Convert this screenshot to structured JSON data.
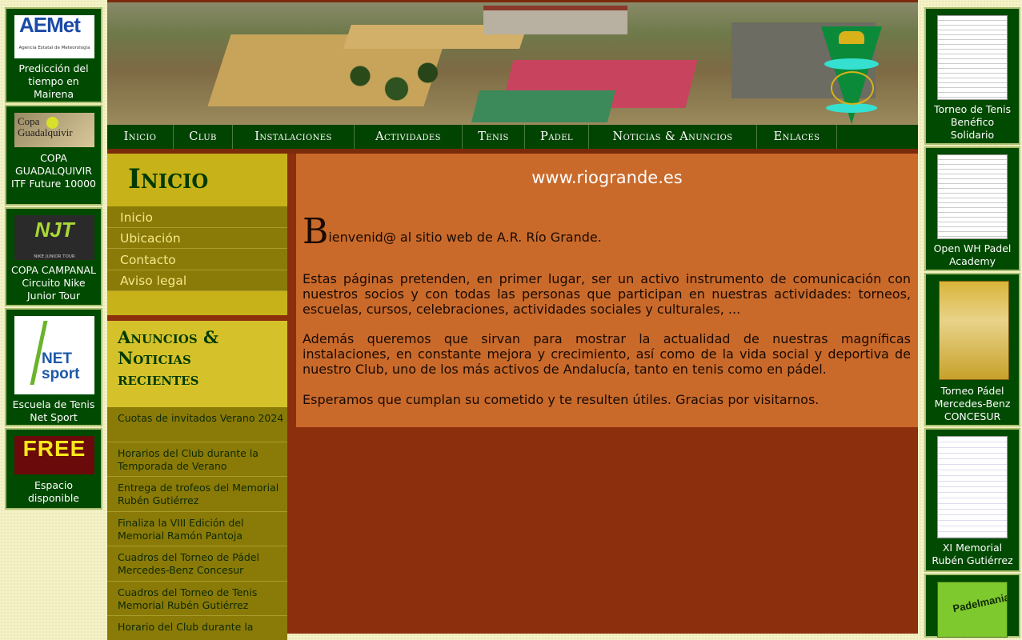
{
  "left_banners": [
    {
      "logo": "AEMet",
      "logo_sub": "Agencia Estatal de Meteorología",
      "caption": "Predicción del tiempo en Mairena"
    },
    {
      "logo": "Copa Guadalquivir",
      "caption": "COPA GUADALQUIVIR ITF Future 10000"
    },
    {
      "logo": "NJT",
      "logo_sub": "NIKE JUNIOR TOUR",
      "caption": "COPA CAMPANAL Circuito Nike Junior Tour"
    },
    {
      "logo": "NET sport",
      "caption": "Escuela de Tenis Net Sport"
    },
    {
      "logo": "FREE",
      "caption": "Espacio disponible"
    }
  ],
  "right_banners": [
    {
      "caption": "Torneo de Tenis Benéfico Solidario"
    },
    {
      "caption": "Open WH Padel Academy"
    },
    {
      "caption": "Torneo Pádel Mercedes-Benz CONCESUR"
    },
    {
      "caption": "XI Memorial Rubén Gutiérrez"
    },
    {
      "caption": "Padelmania"
    }
  ],
  "nav": {
    "items": [
      "Inicio",
      "Club",
      "Instalaciones",
      "Actividades",
      "Tenis",
      "Padel",
      "Noticias & Anuncios",
      "Enlaces"
    ]
  },
  "sidebar": {
    "title": "Inicio",
    "links": [
      "Inicio",
      "Ubicación",
      "Contacto",
      "Aviso legal"
    ],
    "news_title": "Anuncios & Noticias recientes",
    "news": [
      "Cuotas de invitados Verano 2024",
      "Horarios del Club durante la Temporada de Verano",
      "Entrega de trofeos del Memorial Rubén Gutiérrez",
      "Finaliza la VIII Edición del Memorial Ramón Pantoja",
      "Cuadros del Torneo de Pádel Mercedes-Benz Concesur",
      "Cuadros del Torneo de Tenis Memorial Rubén Gutiérrez",
      "Horario del Club durante la"
    ]
  },
  "main": {
    "site_url": "www.riogrande.es",
    "welcome_cap": "B",
    "welcome_rest": "ienvenid@ al sitio web de A.R. Río Grande.",
    "paragraphs": [
      "Estas páginas pretenden, en primer lugar, ser un activo instrumento de comunicación con nuestros socios y con todas las personas que participan en nuestras actividades: torneos, escuelas, cursos, celebraciones, actividades sociales y culturales, ...",
      "Además queremos que sirvan para mostrar la actualidad de nuestras magníficas instalaciones, en constante mejora y crecimiento, así como de la vida social y deportiva de nuestro Club, uno de los más activos de Andalucía, tanto en tenis como en pádel.",
      "Esperamos que cumplan su cometido y te resulten útiles. Gracias por visitarnos."
    ]
  },
  "colors": {
    "nav_bg": "#014401",
    "sidebar_olive": "#8a7a08",
    "sidebar_header": "#c7b21a",
    "main_orange": "#c96a2b",
    "main_dark": "#8b2f0c",
    "banner_green": "#014a01"
  }
}
